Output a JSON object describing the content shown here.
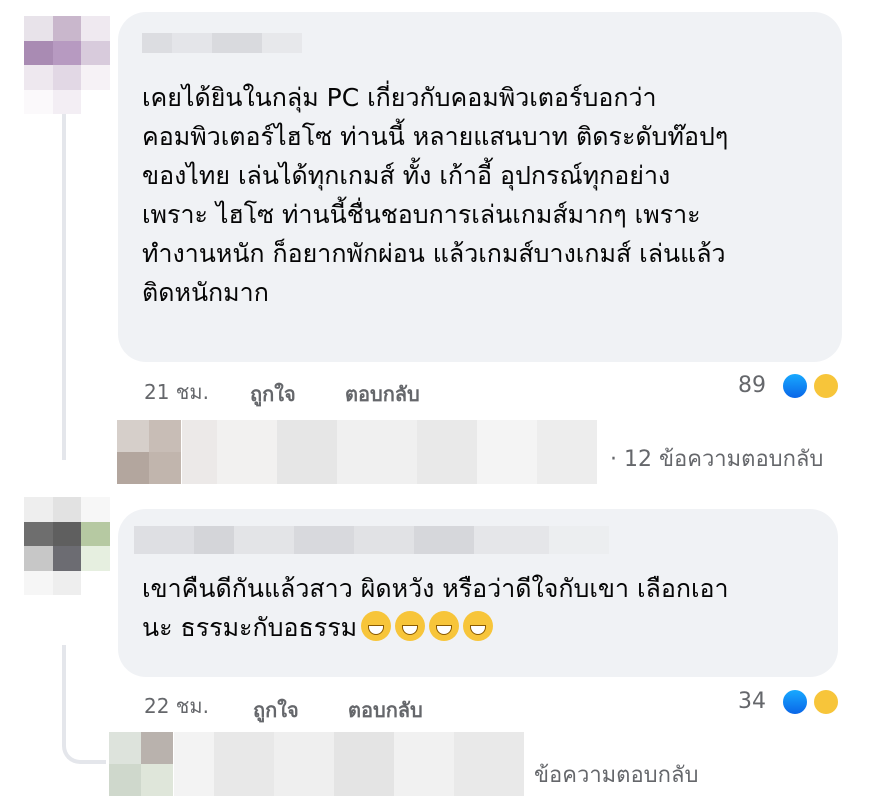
{
  "comments": [
    {
      "text": "เคยได้ยินในกลุ่ม PC เกี่ยวกับคอมพิวเตอร์บอกว่า\nคอมพิวเตอร์ไฮโซ ท่านนี้ หลายแสนบาท ติดระดับท๊อปๆ\nของไทย เล่นได้ทุกเกมส์ ทั้ง เก้าอี้ อุปกรณ์ทุกอย่าง\nเพราะ ไฮโซ ท่านนี้ชื่นชอบการเล่นเกมส์มากๆ เพราะ\nทำงานหนัก ก็อยากพักผ่อน แล้วเกมส์บางเกมส์ เล่นแล้ว\nติดหนักมาก",
      "time": "21 ชม.",
      "like_label": "ถูกใจ",
      "reply_label": "ตอบกลับ",
      "reaction_count": "89",
      "reactions": [
        "like-icon",
        "haha-icon"
      ],
      "replies_link": "· 12 ข้อความตอบกลับ"
    },
    {
      "text": "เขาคืนดีกันแล้วสาว ผิดหวัง หรือว่าดีใจกับเขา เลือกเอา\nนะ ธรรมะกับอธรรม",
      "emoji_count": 4,
      "time": "22 ชม.",
      "like_label": "ถูกใจ",
      "reply_label": "ตอบกลับ",
      "reaction_count": "34",
      "reactions": [
        "like-icon",
        "haha-icon"
      ],
      "replies_link": "ข้อความตอบกลับ"
    }
  ],
  "colors": {
    "bubble": "#f0f2f5",
    "meta": "#65676b",
    "like": "#1877f2",
    "haha": "#f7c53a"
  }
}
